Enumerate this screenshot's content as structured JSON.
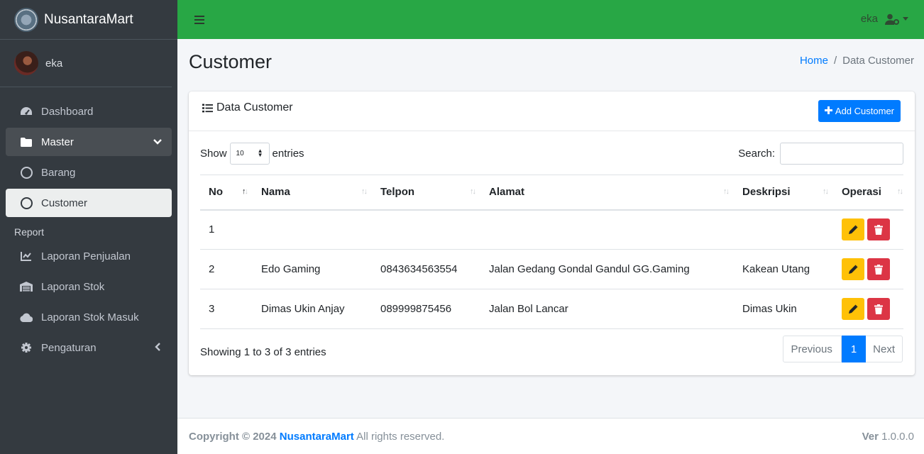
{
  "brand": {
    "name_bold": "Nusantara",
    "name_light": "Mart"
  },
  "sidebar": {
    "user": "eka",
    "items": [
      {
        "label": "Dashboard",
        "icon": "dashboard-icon"
      },
      {
        "label": "Master",
        "icon": "folder-icon"
      },
      {
        "label": "Barang",
        "icon": "circle-icon"
      },
      {
        "label": "Customer",
        "icon": "circle-icon"
      }
    ],
    "report_header": "Report",
    "report_items": [
      {
        "label": "Laporan Penjualan",
        "icon": "chart-line-icon"
      },
      {
        "label": "Laporan Stok",
        "icon": "warehouse-icon"
      },
      {
        "label": "Laporan Stok Masuk",
        "icon": "cloud-icon"
      },
      {
        "label": "Pengaturan",
        "icon": "gear-icon"
      }
    ]
  },
  "topbar": {
    "user": "eka"
  },
  "page": {
    "title": "Customer"
  },
  "breadcrumb": {
    "home": "Home",
    "separator": "/",
    "current": "Data Customer"
  },
  "card": {
    "title": "Data Customer",
    "add_button": "Add Customer",
    "show_label": "Show",
    "entries_label": "entries",
    "page_length": "10",
    "search_label": "Search:",
    "search_value": ""
  },
  "table": {
    "headers": [
      "No",
      "Nama",
      "Telpon",
      "Alamat",
      "Deskripsi",
      "Operasi"
    ],
    "rows": [
      {
        "no": "1",
        "nama": "",
        "telpon": "",
        "alamat": "",
        "deskripsi": ""
      },
      {
        "no": "2",
        "nama": "Edo Gaming",
        "telpon": "0843634563554",
        "alamat": "Jalan Gedang Gondal Gandul GG.Gaming",
        "deskripsi": "Kakean Utang"
      },
      {
        "no": "3",
        "nama": "Dimas Ukin Anjay",
        "telpon": "089999875456",
        "alamat": "Jalan Bol Lancar",
        "deskripsi": "Dimas Ukin"
      }
    ]
  },
  "pagination": {
    "info": "Showing 1 to 3 of 3 entries",
    "previous": "Previous",
    "current": "1",
    "next": "Next"
  },
  "footer": {
    "copyright": "Copyright © 2024",
    "brand": "NusantaraMart",
    "rights": "All rights reserved.",
    "ver_label": "Ver",
    "version": "1.0.0.0"
  },
  "colors": {
    "topbar": "#28a745",
    "sidebar": "#343a40",
    "primary": "#007bff",
    "warning": "#ffc107",
    "danger": "#dc3545"
  }
}
